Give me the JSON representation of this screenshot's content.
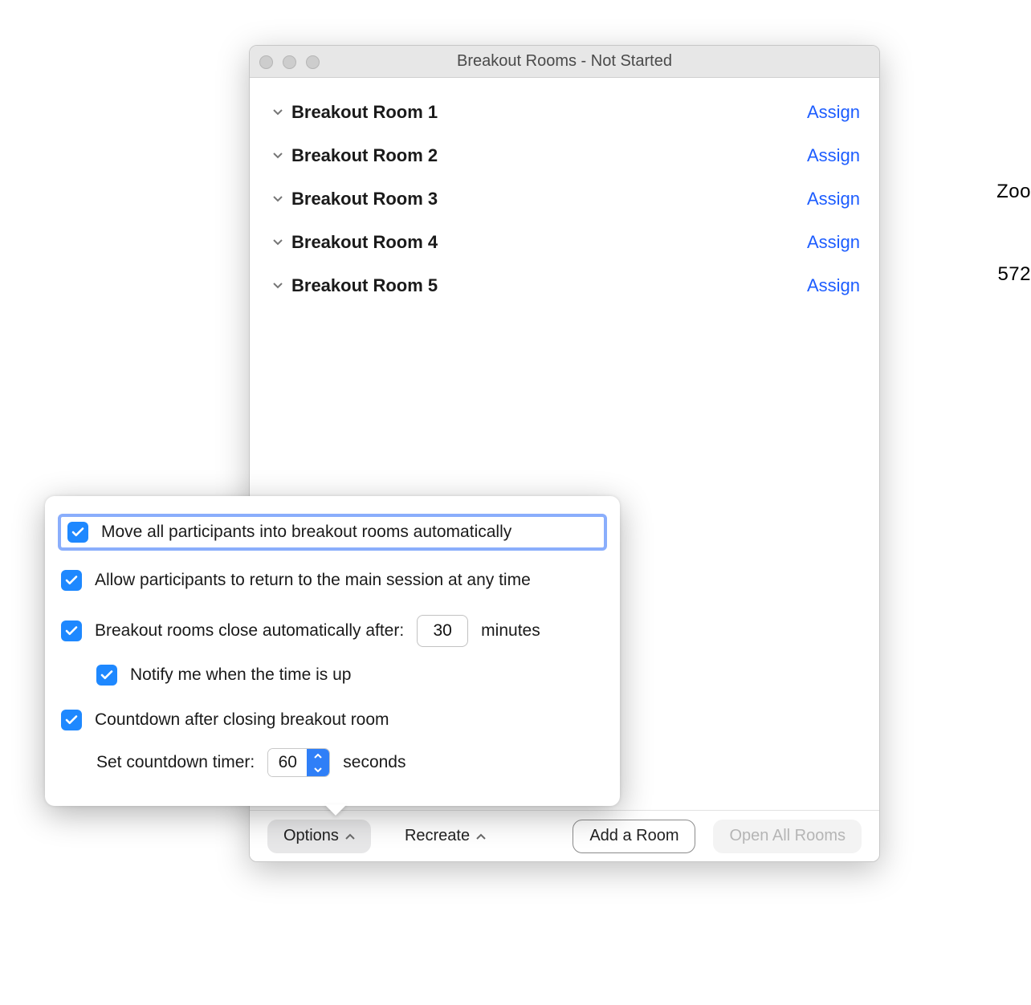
{
  "peek_right_1": "Zoo",
  "peek_right_2": "572",
  "window": {
    "title": "Breakout Rooms - Not Started"
  },
  "rooms": [
    {
      "name": "Breakout Room 1",
      "assign_label": "Assign"
    },
    {
      "name": "Breakout Room 2",
      "assign_label": "Assign"
    },
    {
      "name": "Breakout Room 3",
      "assign_label": "Assign"
    },
    {
      "name": "Breakout Room 4",
      "assign_label": "Assign"
    },
    {
      "name": "Breakout Room 5",
      "assign_label": "Assign"
    }
  ],
  "options": {
    "move_auto": {
      "checked": true,
      "label": "Move all participants into breakout rooms automatically"
    },
    "allow_return": {
      "checked": true,
      "label": "Allow participants to return to the main session at any time"
    },
    "close_after": {
      "checked": true,
      "label_prefix": "Breakout rooms close automatically after:",
      "minutes": "30",
      "label_suffix": "minutes"
    },
    "notify_time_up": {
      "checked": true,
      "label": "Notify me when the time is up"
    },
    "countdown": {
      "checked": true,
      "label": "Countdown after closing breakout room"
    },
    "countdown_timer": {
      "label_prefix": "Set countdown timer:",
      "seconds": "60",
      "label_suffix": "seconds"
    }
  },
  "footer": {
    "options_label": "Options",
    "recreate_label": "Recreate",
    "add_room_label": "Add a Room",
    "open_all_label": "Open All Rooms"
  }
}
